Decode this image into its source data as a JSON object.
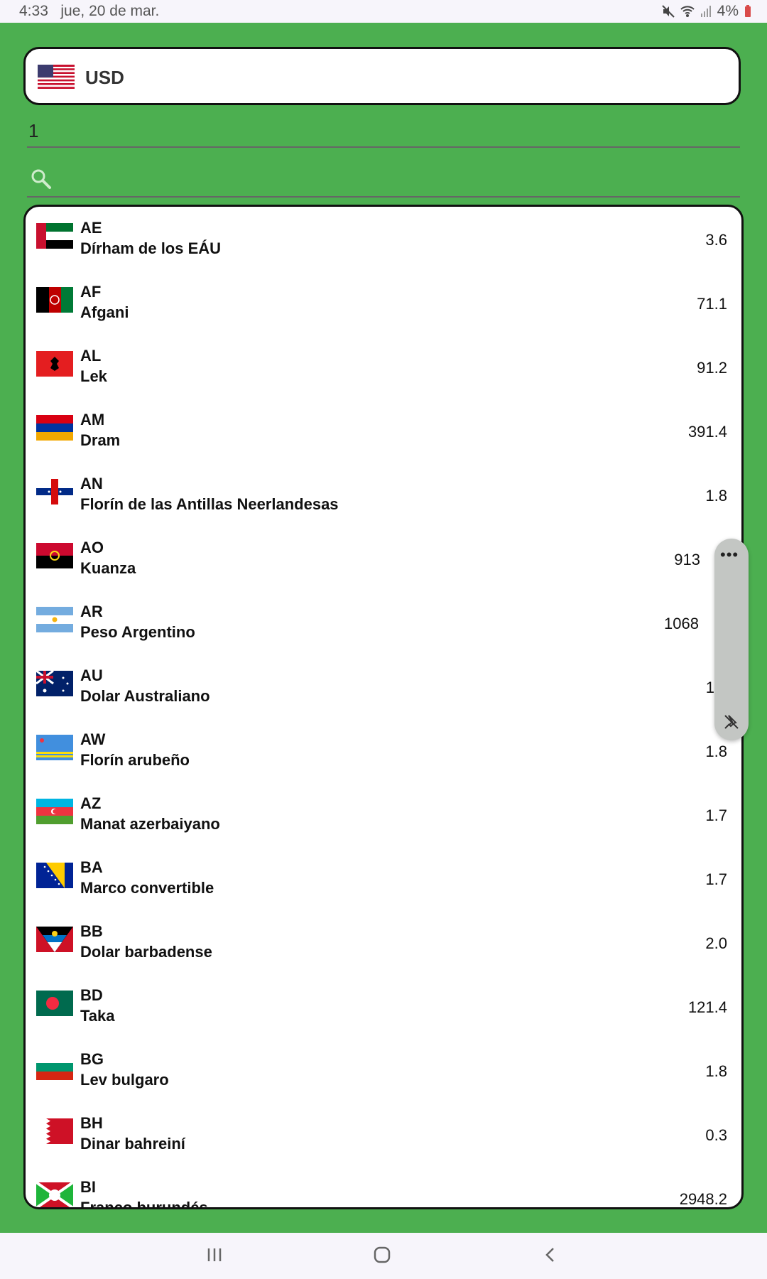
{
  "status": {
    "time": "4:33",
    "date": "jue, 20 de mar.",
    "battery": "4%"
  },
  "base": {
    "code": "USD",
    "flag_icon": "us-flag-icon"
  },
  "amount": {
    "value": "1"
  },
  "search": {
    "placeholder": ""
  },
  "currencies": [
    {
      "code": "AE",
      "name": "Dírham de los EÁU",
      "rate": "3.6"
    },
    {
      "code": "AF",
      "name": "Afgani",
      "rate": "71.1"
    },
    {
      "code": "AL",
      "name": "Lek",
      "rate": "91.2"
    },
    {
      "code": "AM",
      "name": "Dram",
      "rate": "391.4"
    },
    {
      "code": "AN",
      "name": "Florín de las Antillas Neerlandesas",
      "rate": "1.8"
    },
    {
      "code": "AO",
      "name": "Kuanza",
      "rate": "913"
    },
    {
      "code": "AR",
      "name": "Peso Argentino",
      "rate": "1068"
    },
    {
      "code": "AU",
      "name": "Dolar Australiano",
      "rate": "1"
    },
    {
      "code": "AW",
      "name": "Florín arubeño",
      "rate": "1.8"
    },
    {
      "code": "AZ",
      "name": "Manat azerbaiyano",
      "rate": "1.7"
    },
    {
      "code": "BA",
      "name": "Marco convertible",
      "rate": "1.7"
    },
    {
      "code": "BB",
      "name": "Dolar barbadense",
      "rate": "2.0"
    },
    {
      "code": "BD",
      "name": "Taka",
      "rate": "121.4"
    },
    {
      "code": "BG",
      "name": "Lev bulgaro",
      "rate": "1.8"
    },
    {
      "code": "BH",
      "name": "Dinar bahreiní",
      "rate": "0.3"
    },
    {
      "code": "BI",
      "name": "Franco burundés",
      "rate": "2948.2"
    }
  ],
  "colors": {
    "background": "#4caf50",
    "card": "#ffffff",
    "border": "#111111"
  }
}
